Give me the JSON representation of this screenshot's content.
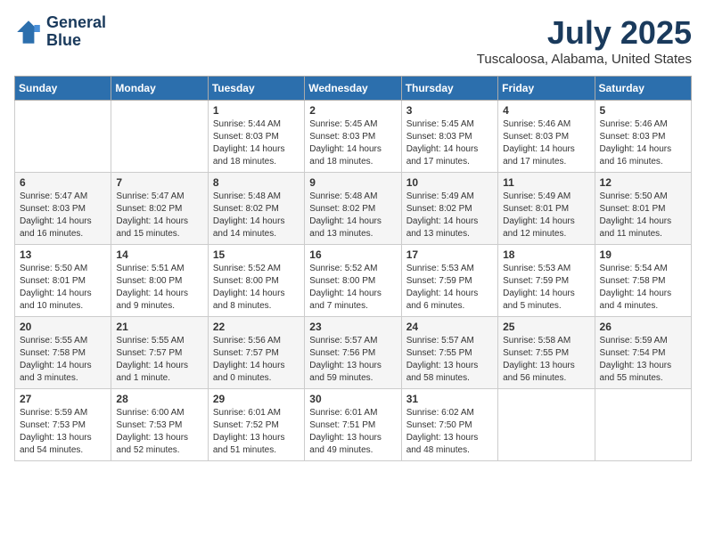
{
  "header": {
    "logo_line1": "General",
    "logo_line2": "Blue",
    "month_year": "July 2025",
    "location": "Tuscaloosa, Alabama, United States"
  },
  "weekdays": [
    "Sunday",
    "Monday",
    "Tuesday",
    "Wednesday",
    "Thursday",
    "Friday",
    "Saturday"
  ],
  "weeks": [
    [
      null,
      null,
      {
        "day": 1,
        "sunrise": "5:44 AM",
        "sunset": "8:03 PM",
        "daylight": "14 hours and 18 minutes."
      },
      {
        "day": 2,
        "sunrise": "5:45 AM",
        "sunset": "8:03 PM",
        "daylight": "14 hours and 18 minutes."
      },
      {
        "day": 3,
        "sunrise": "5:45 AM",
        "sunset": "8:03 PM",
        "daylight": "14 hours and 17 minutes."
      },
      {
        "day": 4,
        "sunrise": "5:46 AM",
        "sunset": "8:03 PM",
        "daylight": "14 hours and 17 minutes."
      },
      {
        "day": 5,
        "sunrise": "5:46 AM",
        "sunset": "8:03 PM",
        "daylight": "14 hours and 16 minutes."
      }
    ],
    [
      {
        "day": 6,
        "sunrise": "5:47 AM",
        "sunset": "8:03 PM",
        "daylight": "14 hours and 16 minutes."
      },
      {
        "day": 7,
        "sunrise": "5:47 AM",
        "sunset": "8:02 PM",
        "daylight": "14 hours and 15 minutes."
      },
      {
        "day": 8,
        "sunrise": "5:48 AM",
        "sunset": "8:02 PM",
        "daylight": "14 hours and 14 minutes."
      },
      {
        "day": 9,
        "sunrise": "5:48 AM",
        "sunset": "8:02 PM",
        "daylight": "14 hours and 13 minutes."
      },
      {
        "day": 10,
        "sunrise": "5:49 AM",
        "sunset": "8:02 PM",
        "daylight": "14 hours and 13 minutes."
      },
      {
        "day": 11,
        "sunrise": "5:49 AM",
        "sunset": "8:01 PM",
        "daylight": "14 hours and 12 minutes."
      },
      {
        "day": 12,
        "sunrise": "5:50 AM",
        "sunset": "8:01 PM",
        "daylight": "14 hours and 11 minutes."
      }
    ],
    [
      {
        "day": 13,
        "sunrise": "5:50 AM",
        "sunset": "8:01 PM",
        "daylight": "14 hours and 10 minutes."
      },
      {
        "day": 14,
        "sunrise": "5:51 AM",
        "sunset": "8:00 PM",
        "daylight": "14 hours and 9 minutes."
      },
      {
        "day": 15,
        "sunrise": "5:52 AM",
        "sunset": "8:00 PM",
        "daylight": "14 hours and 8 minutes."
      },
      {
        "day": 16,
        "sunrise": "5:52 AM",
        "sunset": "8:00 PM",
        "daylight": "14 hours and 7 minutes."
      },
      {
        "day": 17,
        "sunrise": "5:53 AM",
        "sunset": "7:59 PM",
        "daylight": "14 hours and 6 minutes."
      },
      {
        "day": 18,
        "sunrise": "5:53 AM",
        "sunset": "7:59 PM",
        "daylight": "14 hours and 5 minutes."
      },
      {
        "day": 19,
        "sunrise": "5:54 AM",
        "sunset": "7:58 PM",
        "daylight": "14 hours and 4 minutes."
      }
    ],
    [
      {
        "day": 20,
        "sunrise": "5:55 AM",
        "sunset": "7:58 PM",
        "daylight": "14 hours and 3 minutes."
      },
      {
        "day": 21,
        "sunrise": "5:55 AM",
        "sunset": "7:57 PM",
        "daylight": "14 hours and 1 minute."
      },
      {
        "day": 22,
        "sunrise": "5:56 AM",
        "sunset": "7:57 PM",
        "daylight": "14 hours and 0 minutes."
      },
      {
        "day": 23,
        "sunrise": "5:57 AM",
        "sunset": "7:56 PM",
        "daylight": "13 hours and 59 minutes."
      },
      {
        "day": 24,
        "sunrise": "5:57 AM",
        "sunset": "7:55 PM",
        "daylight": "13 hours and 58 minutes."
      },
      {
        "day": 25,
        "sunrise": "5:58 AM",
        "sunset": "7:55 PM",
        "daylight": "13 hours and 56 minutes."
      },
      {
        "day": 26,
        "sunrise": "5:59 AM",
        "sunset": "7:54 PM",
        "daylight": "13 hours and 55 minutes."
      }
    ],
    [
      {
        "day": 27,
        "sunrise": "5:59 AM",
        "sunset": "7:53 PM",
        "daylight": "13 hours and 54 minutes."
      },
      {
        "day": 28,
        "sunrise": "6:00 AM",
        "sunset": "7:53 PM",
        "daylight": "13 hours and 52 minutes."
      },
      {
        "day": 29,
        "sunrise": "6:01 AM",
        "sunset": "7:52 PM",
        "daylight": "13 hours and 51 minutes."
      },
      {
        "day": 30,
        "sunrise": "6:01 AM",
        "sunset": "7:51 PM",
        "daylight": "13 hours and 49 minutes."
      },
      {
        "day": 31,
        "sunrise": "6:02 AM",
        "sunset": "7:50 PM",
        "daylight": "13 hours and 48 minutes."
      },
      null,
      null
    ]
  ]
}
